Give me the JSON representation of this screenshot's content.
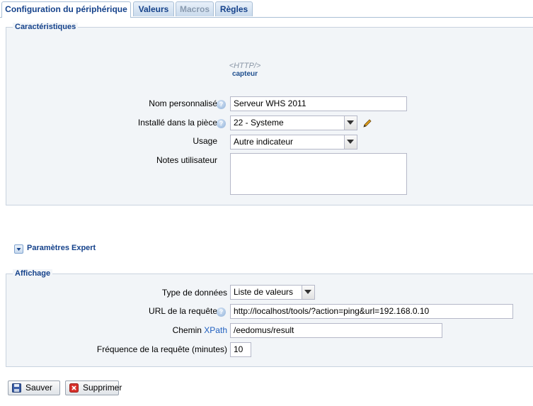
{
  "tabs": [
    {
      "label": "Configuration du périphérique",
      "state": "active"
    },
    {
      "label": "Valeurs",
      "state": "normal"
    },
    {
      "label": "Macros",
      "state": "disabled"
    },
    {
      "label": "Règles",
      "state": "normal"
    }
  ],
  "caracteristiques": {
    "legend": "Caractéristiques",
    "device_icon_text": "<HTTP/>",
    "device_type_label": "capteur",
    "fields": {
      "nom": {
        "label": "Nom personnalisé",
        "value": "Serveur WHS 2011"
      },
      "piece": {
        "label": "Installé dans la pièce",
        "value": "22 - Systeme"
      },
      "usage": {
        "label": "Usage",
        "value": "Autre indicateur"
      },
      "notes": {
        "label": "Notes utilisateur",
        "value": ""
      }
    }
  },
  "expert": {
    "label": "Paramètres Expert"
  },
  "affichage": {
    "legend": "Affichage",
    "fields": {
      "type": {
        "label": "Type de données",
        "value": "Liste de valeurs"
      },
      "url": {
        "label": "URL de la requête",
        "value": "http://localhost/tools/?action=ping&url=192.168.0.10"
      },
      "chemin": {
        "label": "Chemin",
        "link": "XPath",
        "value": "/eedomus/result"
      },
      "frequence": {
        "label": "Fréquence de la requête (minutes)",
        "value": "10"
      }
    }
  },
  "buttons": {
    "save": "Sauver",
    "delete": "Supprimer"
  },
  "colors": {
    "accent": "#15428b",
    "link": "#1f5fbf",
    "panel_bg": "#f2f5f8",
    "border": "#c9d3df"
  }
}
